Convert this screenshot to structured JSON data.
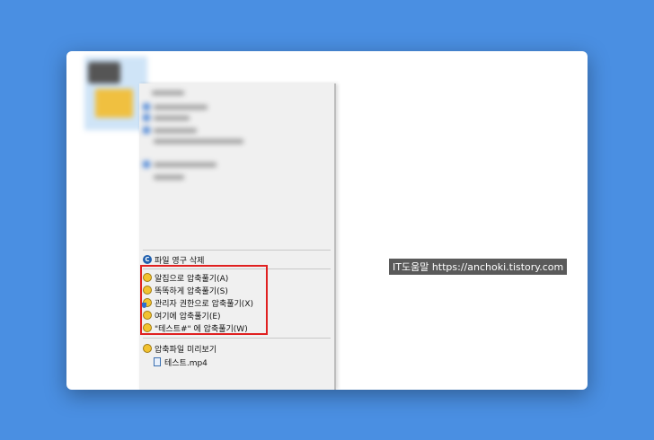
{
  "context_menu": {
    "delete_permanently": "파일 영구 삭제",
    "compress_items": [
      {
        "label": "알집으로 압축풀기(A)",
        "icon": "alzip-icon"
      },
      {
        "label": "똑똑하게 압축풀기(S)",
        "icon": "alzip-icon"
      },
      {
        "label": "관리자 권한으로 압축풀기(X)",
        "icon": "alzip-admin-shield-icon"
      },
      {
        "label": "여기에 압축풀기(E)",
        "icon": "alzip-icon"
      },
      {
        "label": "\"테스트#\" 에 압축풀기(W)",
        "icon": "alzip-icon"
      }
    ],
    "preview_label": "압축파일 미리보기",
    "preview_file": "테스트.mp4"
  },
  "watermark": {
    "text": "IT도움말 https://anchoki.tistory.com"
  },
  "colors": {
    "background": "#4a8fe2",
    "highlight": "#e02020",
    "menu": "#f0f0f0"
  }
}
